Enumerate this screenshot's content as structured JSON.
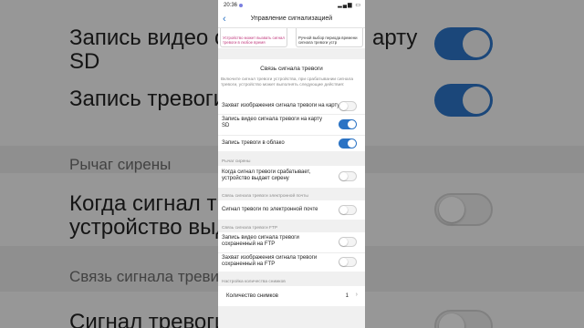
{
  "background": {
    "lines": [
      "Запись видео с",
      "SD",
      "Запись тревоги",
      "Рычаг сирены",
      "Когда сигнал тр",
      "устройство выд",
      "Связь сигнала треви",
      "Сигнал тревоги по"
    ],
    "right_fragment": "арту"
  },
  "status_bar": {
    "time": "20:36",
    "icons": "▂▄▆ ▭"
  },
  "nav": {
    "back_icon": "chevron-left",
    "title": "Управление сигнализацией"
  },
  "cards": [
    {
      "text": "Устройство может вызвать сигнал тревоги в любое время"
    },
    {
      "text": "Ручной выбор периода времени сигнала тревоги устр"
    }
  ],
  "alarm_link": {
    "title": "Связь сигнала тревоги",
    "description": "Включите сигнал тревоги устройства, при срабатывании сигнала тревоги, устройство может выполнять следующие действия:",
    "items": [
      {
        "label": "Захват изображения сигнала тревоги на карту SD",
        "on": false
      },
      {
        "label": "Запись видео сигнала тревоги на карту SD",
        "on": true
      },
      {
        "label": "Запись тревоги в облако",
        "on": true
      }
    ]
  },
  "siren": {
    "header": "Рычаг сирены",
    "item": {
      "label": "Когда сигнал тревоги срабатывает, устройство выдает сирену",
      "on": false
    }
  },
  "email": {
    "header": "Связь сигнала тревоги электронной почты",
    "item": {
      "label": "Сигнал тревоги по электронной почте",
      "on": false
    }
  },
  "ftp": {
    "header": "Связь сигнала тревоги FTP",
    "items": [
      {
        "label": "Запись видео сигнала тревоги сохраненный на FTP",
        "on": false
      },
      {
        "label": "Захват изображения сигнала тревоги сохраненный на FTP",
        "on": false
      }
    ]
  },
  "snapshots": {
    "header": "Настройка количества снимков",
    "label": "Количество снимков",
    "value": "1",
    "chevron": "›"
  },
  "colors": {
    "accent": "#2b73c4",
    "pink_text": "#c0397d"
  }
}
